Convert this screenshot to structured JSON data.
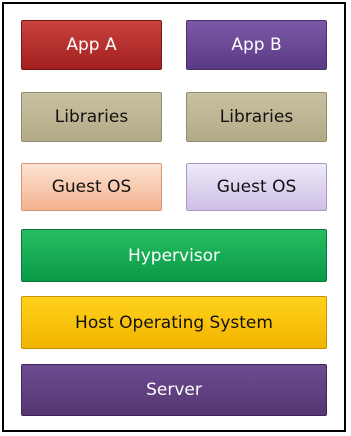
{
  "layers": {
    "app_a": "App A",
    "app_b": "App B",
    "libraries_a": "Libraries",
    "libraries_b": "Libraries",
    "guest_os_a": "Guest OS",
    "guest_os_b": "Guest OS",
    "hypervisor": "Hypervisor",
    "host_os": "Host Operating System",
    "server": "Server"
  },
  "colors": {
    "app_a": "#b32b29",
    "app_b": "#6a4896",
    "libraries": "#bdb592",
    "guest_os_a": "#f8c9ae",
    "guest_os_b": "#ddd3ef",
    "hypervisor": "#16aa52",
    "host_os": "#f9c30a",
    "server": "#614180"
  }
}
